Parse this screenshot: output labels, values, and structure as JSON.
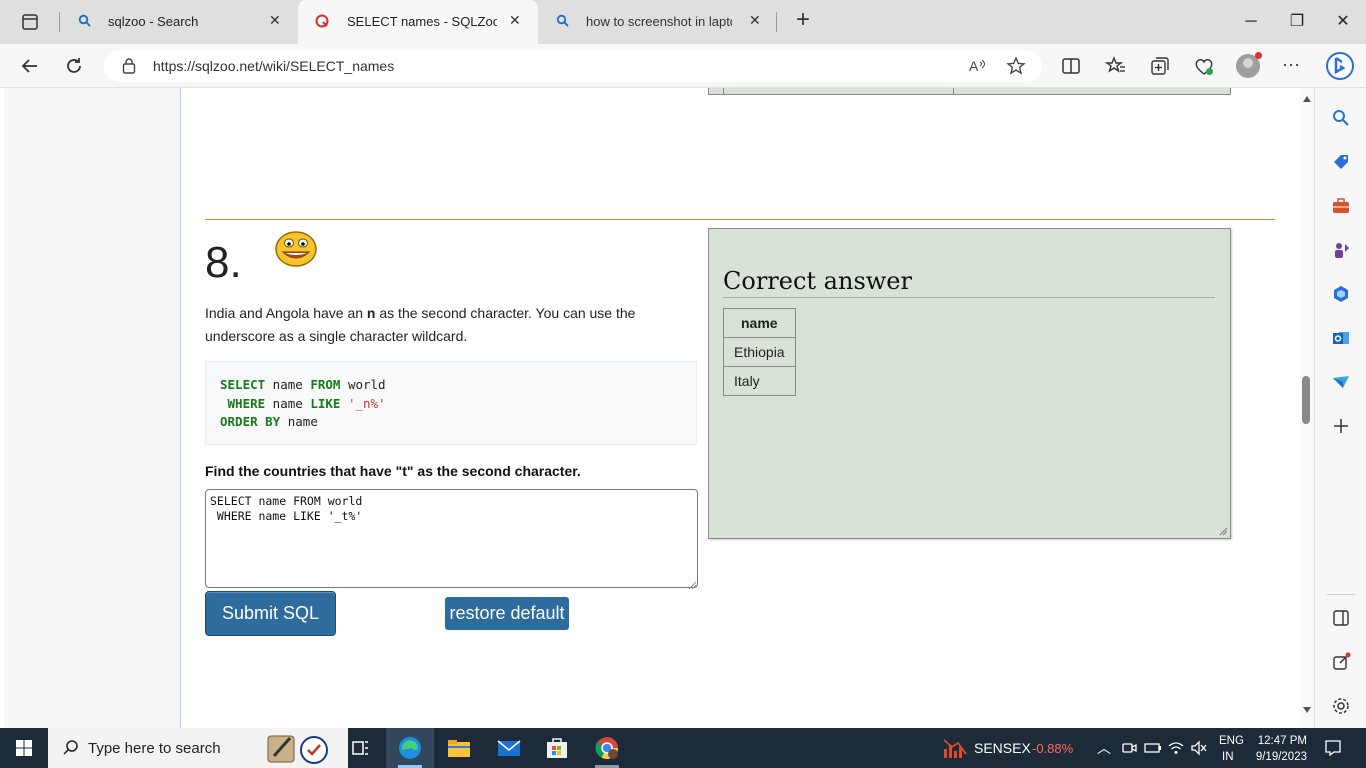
{
  "browser": {
    "tabs": [
      {
        "title": "sqlzoo - Search",
        "icon": "search-icon"
      },
      {
        "title": "SELECT names - SQLZoo",
        "icon": "sqlzoo-icon",
        "active": true
      },
      {
        "title": "how to screenshot in lapto",
        "icon": "search-icon"
      }
    ],
    "url": "https://sqlzoo.net/wiki/SELECT_names"
  },
  "question": {
    "number": "8.",
    "text_before_bold": "India and Angola have an ",
    "bold": "n",
    "text_after_bold": " as the second character. You can use the underscore as a single character wildcard.",
    "example_code": {
      "line1_kw1": "SELECT",
      "line1_rest1": " name ",
      "line1_kw2": "FROM",
      "line1_rest2": " world",
      "line2_kw1": " WHERE",
      "line2_rest1": " name ",
      "line2_kw2": "LIKE",
      "line2_str": " '_n%'",
      "line3_kw1": "ORDER BY",
      "line3_rest1": " name"
    },
    "task": "Find the countries that have \"t\" as the second character.",
    "editor_value": "SELECT name FROM world\n WHERE name LIKE '_t%'",
    "submit_label": "Submit SQL",
    "restore_label": "restore default"
  },
  "answer": {
    "title": "Correct answer",
    "column": "name",
    "rows": [
      "Ethiopia",
      "Italy"
    ]
  },
  "taskbar": {
    "search_placeholder": "Type here to search",
    "ticker_name": "SENSEX",
    "ticker_value": "-0.88%",
    "lang_line1": "ENG",
    "lang_line2": "IN",
    "time": "12:47 PM",
    "date": "9/19/2023"
  },
  "colors": {
    "accent": "#2e6c9e",
    "answer_bg": "#d9e2d6",
    "rule": "#e08a25",
    "ticker_negative": "#ff6b5b"
  }
}
